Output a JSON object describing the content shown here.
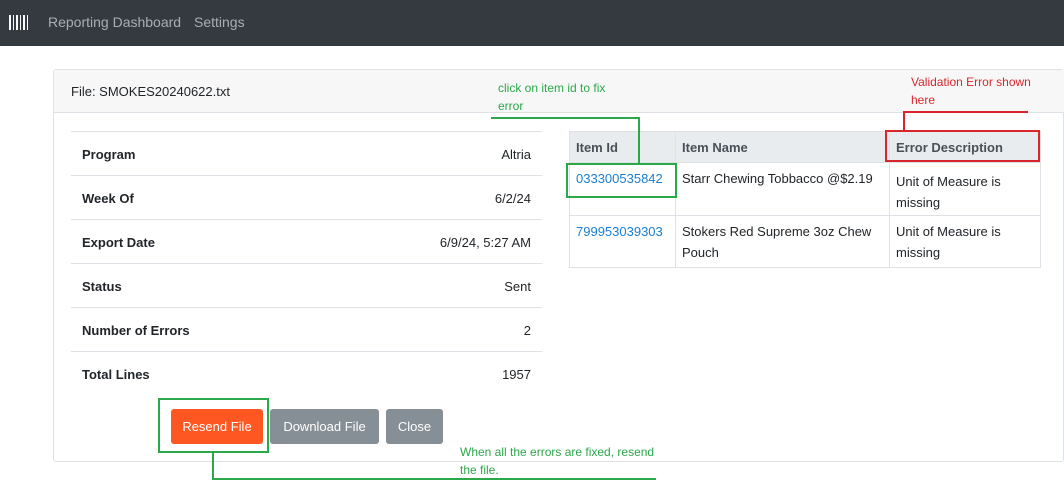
{
  "nav": {
    "brand_icon": "barcode-icon",
    "links": [
      "Reporting Dashboard",
      "Settings"
    ]
  },
  "file": {
    "title": "File: SMOKES20240622.txt"
  },
  "details": [
    {
      "label": "Program",
      "value": "Altria"
    },
    {
      "label": "Week Of",
      "value": "6/2/24"
    },
    {
      "label": "Export Date",
      "value": "6/9/24, 5:27 AM"
    },
    {
      "label": "Status",
      "value": "Sent"
    },
    {
      "label": "Number of Errors",
      "value": "2"
    },
    {
      "label": "Total Lines",
      "value": "1957"
    }
  ],
  "errors_table": {
    "headers": [
      "Item Id",
      "Item Name",
      "Error Description"
    ],
    "rows": [
      {
        "item_id": "033300535842",
        "item_name": "Starr Chewing Tobbacco @$2.19",
        "error": "Unit of Measure is missing"
      },
      {
        "item_id": "799953039303",
        "item_name": "Stokers Red Supreme 3oz Chew Pouch",
        "error": "Unit of Measure is missing"
      }
    ]
  },
  "buttons": {
    "resend": "Resend File",
    "download": "Download File",
    "close": "Close"
  },
  "annotations": {
    "click_item": "click on item id to fix error",
    "validation": "Validation Error shown here",
    "resend": "When all the errors are fixed, resend the file."
  },
  "colors": {
    "navbar": "#343a40",
    "resend_button": "#ff5722",
    "secondary_button": "#868e96",
    "link": "#1a7fd4",
    "annotation_green": "#2aa84a",
    "annotation_red": "#d9262c"
  }
}
